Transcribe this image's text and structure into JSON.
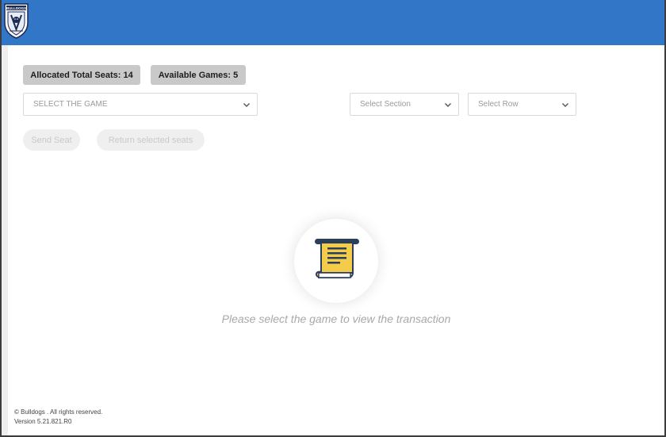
{
  "header": {
    "brand_color": "#3176c7",
    "logo_text": "BULLDOGS",
    "logo_icon": "bulldogs-shield-icon"
  },
  "stats": {
    "allocated_seats": "Allocated Total Seats: 14",
    "available_games": "Available Games: 5"
  },
  "filters": {
    "game_select": "SELECT THE GAME",
    "section_select": "Select Section",
    "row_select": "Select Row"
  },
  "actions": {
    "send_seat": "Send Seat",
    "return_seats": "Return selected seats"
  },
  "empty_state": {
    "icon": "scroll-receipt-icon",
    "message": "Please select the game to view the transaction"
  },
  "footer": {
    "copyright": "© Bulldogs . All rights reserved.",
    "version": "Version 5.21.821.R0"
  }
}
